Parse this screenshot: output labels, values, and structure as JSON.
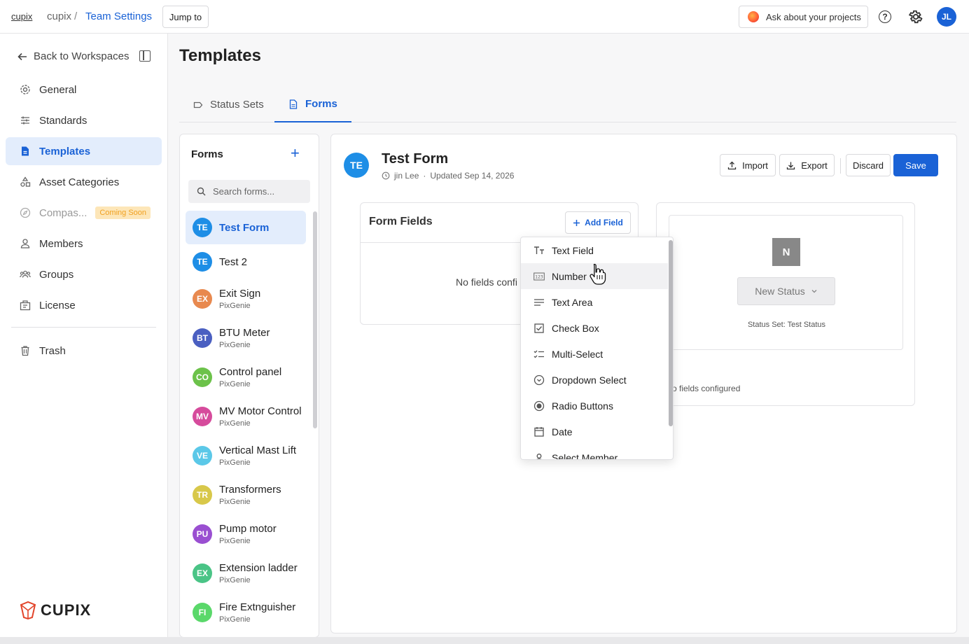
{
  "topbar": {
    "crumb_link": "cupix",
    "crumb_workspace": "cupix",
    "crumb_sep": "/",
    "crumb_current": "Team Settings",
    "jump_label": "Jump to",
    "ask_label": "Ask about your projects",
    "help_label": "?",
    "avatar_initials": "JL"
  },
  "sidebar": {
    "back_label": "Back to Workspaces",
    "items": [
      {
        "label": "General",
        "icon": "gear-icon"
      },
      {
        "label": "Standards",
        "icon": "sliders-icon"
      },
      {
        "label": "Templates",
        "icon": "document-icon"
      },
      {
        "label": "Asset Categories",
        "icon": "shapes-icon"
      },
      {
        "label": "Compas...",
        "icon": "compass-icon",
        "badge": "Coming Soon"
      },
      {
        "label": "Members",
        "icon": "person-icon"
      },
      {
        "label": "Groups",
        "icon": "people-icon"
      },
      {
        "label": "License",
        "icon": "license-icon"
      },
      {
        "label": "Trash",
        "icon": "trash-icon"
      }
    ],
    "logo_text": "CUPIX"
  },
  "main": {
    "title": "Templates",
    "tabs": [
      {
        "label": "Status Sets",
        "icon": "tag-icon"
      },
      {
        "label": "Forms",
        "icon": "document-icon"
      }
    ]
  },
  "forms_panel": {
    "title": "Forms",
    "add_label": "+",
    "search_placeholder": "Search forms...",
    "items": [
      {
        "initials": "TE",
        "name": "Test Form",
        "sub": "",
        "color": "#1e8ee6"
      },
      {
        "initials": "TE",
        "name": "Test 2",
        "sub": "",
        "color": "#1e8ee6"
      },
      {
        "initials": "EX",
        "name": "Exit Sign",
        "sub": "PixGenie",
        "color": "#e8894f"
      },
      {
        "initials": "BT",
        "name": "BTU Meter",
        "sub": "PixGenie",
        "color": "#4a5fc1"
      },
      {
        "initials": "CO",
        "name": "Control panel",
        "sub": "PixGenie",
        "color": "#6cc24a"
      },
      {
        "initials": "MV",
        "name": "MV Motor Control",
        "sub": "PixGenie",
        "color": "#d64b9c"
      },
      {
        "initials": "VE",
        "name": "Vertical Mast Lift",
        "sub": "PixGenie",
        "color": "#5bc8e8"
      },
      {
        "initials": "TR",
        "name": "Transformers",
        "sub": "PixGenie",
        "color": "#d8c84a"
      },
      {
        "initials": "PU",
        "name": "Pump motor",
        "sub": "PixGenie",
        "color": "#9a4fd1"
      },
      {
        "initials": "EX",
        "name": "Extension ladder",
        "sub": "PixGenie",
        "color": "#4ac486"
      },
      {
        "initials": "FI",
        "name": "Fire Extnguisher",
        "sub": "PixGenie",
        "color": "#5ad86a"
      }
    ]
  },
  "editor": {
    "avatar_initials": "TE",
    "form_title": "Test Form",
    "author": "jin Lee",
    "dot": "·",
    "updated": "Updated Sep 14, 2026",
    "import_label": "Import",
    "export_label": "Export",
    "discard_label": "Discard",
    "save_label": "Save",
    "fields_title": "Form Fields",
    "add_field_label": "Add Field",
    "no_fields_text": "No fields confi",
    "preview": {
      "badge_letter": "N",
      "status_label": "New Status",
      "status_set_text": "Status Set: Test Status",
      "no_fields_text": "o fields configured"
    }
  },
  "field_menu": {
    "items": [
      {
        "label": "Text Field",
        "icon": "text-field-icon"
      },
      {
        "label": "Number",
        "icon": "number-icon"
      },
      {
        "label": "Text Area",
        "icon": "text-area-icon"
      },
      {
        "label": "Check Box",
        "icon": "checkbox-icon"
      },
      {
        "label": "Multi-Select",
        "icon": "multi-select-icon"
      },
      {
        "label": "Dropdown Select",
        "icon": "dropdown-select-icon"
      },
      {
        "label": "Radio Buttons",
        "icon": "radio-icon"
      },
      {
        "label": "Date",
        "icon": "calendar-icon"
      },
      {
        "label": "Select Member",
        "icon": "member-icon"
      }
    ],
    "hovered_index": 1
  },
  "colors": {
    "accent": "#1a62d6",
    "active_bg": "#e3edfc",
    "coming_soon_bg": "#fde6b8",
    "coming_soon_text": "#f0a020"
  }
}
